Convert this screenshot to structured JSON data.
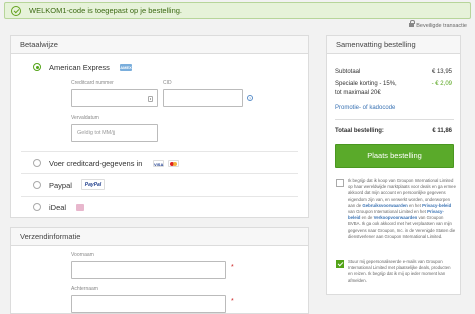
{
  "banner": {
    "text": "WELKOM1-code is toegepast op je bestelling."
  },
  "secure": {
    "text": "Beveiligde transactie"
  },
  "payment": {
    "title": "Betaalwijze",
    "amex": {
      "label": "American Express",
      "logo": "AMEX",
      "card_number_label": "Creditcard nummer",
      "cvc_label": "CID",
      "expiry_label": "Vervaldatum",
      "expiry_placeholder": "Geldig tot MM/jj",
      "help": "?"
    },
    "creditcard": {
      "label": "Voer creditcard-gegevens in",
      "logo_visa": "VISA"
    },
    "paypal": {
      "label": "Paypal",
      "logo": "PayPal"
    },
    "ideal": {
      "label": "iDeal"
    }
  },
  "shipping": {
    "title": "Verzendinformatie",
    "first_name_label": "Voornaam",
    "last_name_label": "Achternaam",
    "required_mark": "*"
  },
  "summary": {
    "title": "Samenvatting bestelling",
    "subtotal_label": "Subtotaal",
    "subtotal_value": "€ 13,95",
    "discount_label_1": "Speciale korting - 15%,",
    "discount_label_2": "tot maximaal 20€",
    "discount_value": "- € 2,09",
    "promo_link": "Promotie- of kadocode",
    "total_label": "Totaal bestelling:",
    "total_value": "€ 11,86",
    "place_order": "Plaats bestelling",
    "consent1": {
      "text_1": "Ik begrijp dat ik koop van Groupon International Limited op haar wereldwijde marktplaats voor deals en ga ermee akkoord dat mijn account en persoonlijke gegevens eigendom zijn van, en verwerkt worden, onderworpen aan de",
      "link_1": "Gebruiksvoorwaarden",
      "text_2": "en het",
      "link_2": "Privacy-beleid",
      "text_3": "van Groupon International Limited en het",
      "link_3": "Privacy-beleid",
      "text_4": "en de",
      "link_4": "Verkoopvoorwaarden",
      "text_5": "van Groupon BVBA. Ik ga ook akkoord met het verplaatsen van mijn gegevens naar Groupon, Inc. in de Verenigde Staten die dienstverlener aan Groupon International Limited."
    },
    "consent2": {
      "text": "Stuur mij gepersonaliseerde e-mails van Groupon International Limited met plaatselijke deals, producten en reizen. Ik begrijp dat ik mij op ieder moment kan afmelden."
    }
  },
  "colors": {
    "accent": "#53a318",
    "link": "#3a73b4",
    "banner_bg": "#e6f2d9"
  },
  "icons": [
    "check-circle-icon",
    "lock-icon",
    "card-icon",
    "help-icon"
  ]
}
